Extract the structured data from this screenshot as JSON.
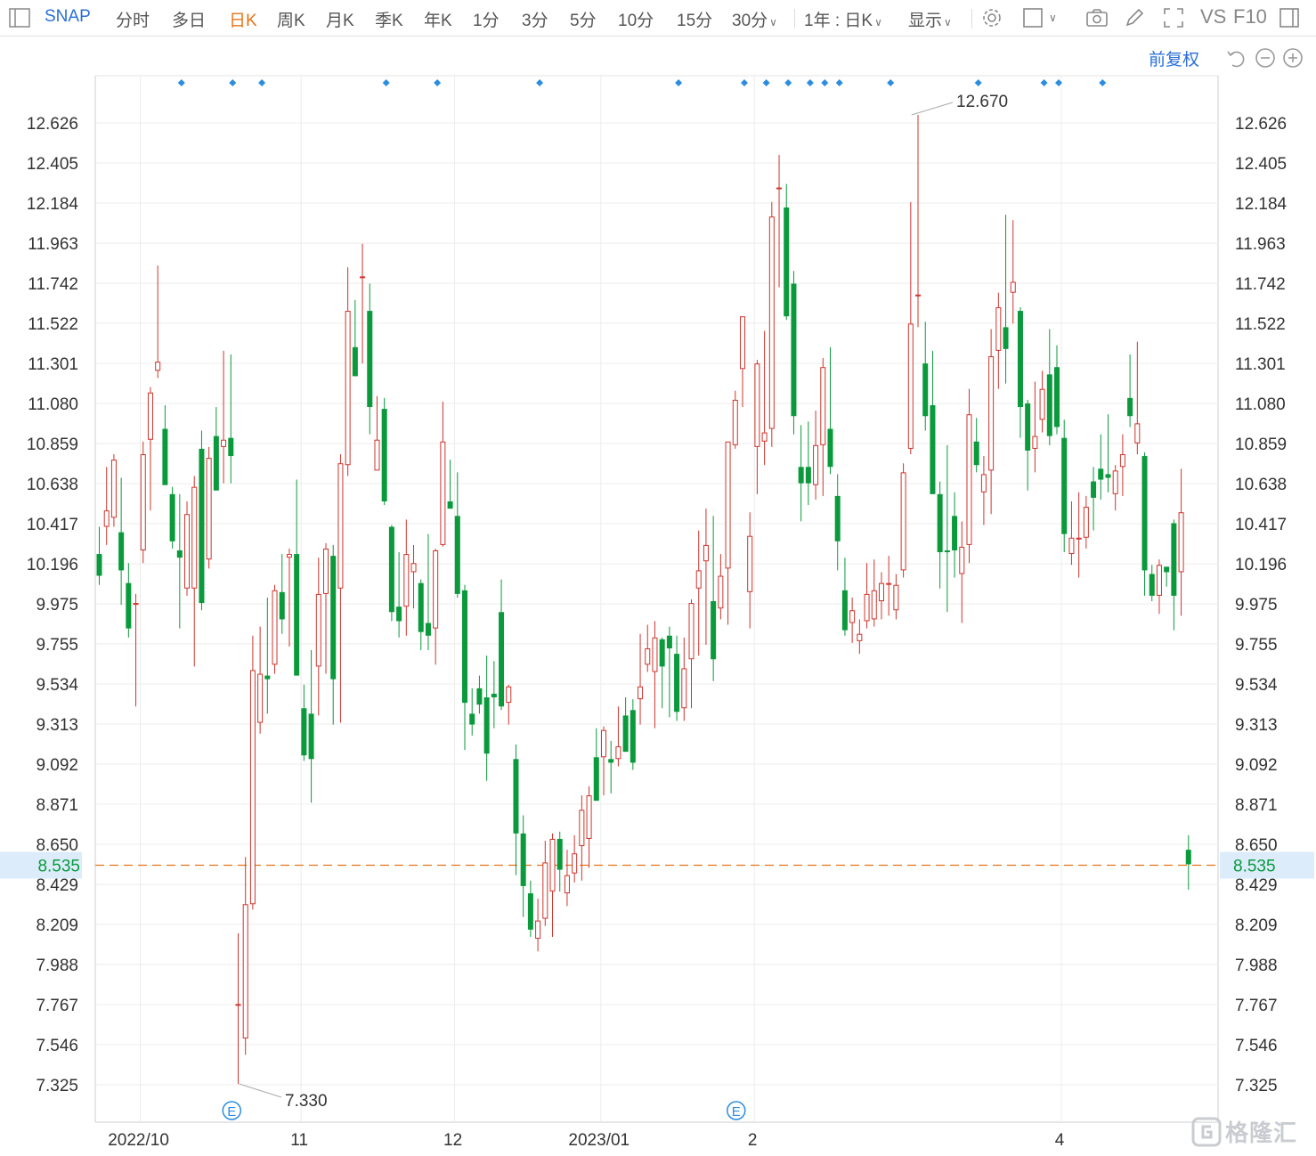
{
  "toolbar": {
    "ticker": "SNAP",
    "tabs": [
      "分时",
      "多日",
      "日K",
      "周K",
      "月K",
      "季K",
      "年K",
      "1分",
      "3分",
      "5分",
      "10分",
      "15分",
      "30分"
    ],
    "active_tab": "日K",
    "range_select": "1年 : 日K",
    "display_select": "显示",
    "vs_label": "VS",
    "f10_label": "F10"
  },
  "subbar": {
    "adjust_label": "前复权"
  },
  "watermark": {
    "text": "格隆汇"
  },
  "colors": {
    "up": "#d0342c",
    "down": "#0a9a3c",
    "current_line": "#e8741a",
    "current_bg": "#dcecfb",
    "grid": "#ececec",
    "marker": "#2a8de0"
  },
  "chart_data": {
    "type": "candlestick",
    "y_ticks": [
      "12.626",
      "12.405",
      "12.184",
      "11.963",
      "11.742",
      "11.522",
      "11.301",
      "11.080",
      "10.859",
      "10.638",
      "10.417",
      "10.196",
      "9.975",
      "9.755",
      "9.534",
      "9.313",
      "9.092",
      "8.871",
      "8.650",
      "8.429",
      "8.209",
      "7.988",
      "7.767",
      "7.546",
      "7.325"
    ],
    "ylim": [
      7.105,
      12.847
    ],
    "x_labels": [
      {
        "label": "2022/10",
        "index": 5
      },
      {
        "label": "11",
        "index": 27
      },
      {
        "label": "12",
        "index": 48
      },
      {
        "label": "2023/01",
        "index": 68
      },
      {
        "label": "2",
        "index": 89
      },
      {
        "label": "4",
        "index": 131
      }
    ],
    "grid_lines_at_index": [
      5,
      27,
      48,
      68,
      89,
      131
    ],
    "current_price": "8.535",
    "max_annotation": {
      "label": "12.670",
      "index": 111,
      "value": 12.67
    },
    "min_annotation": {
      "label": "7.330",
      "index": 19,
      "value": 7.33
    },
    "earnings_markers": [
      {
        "label": "E",
        "index": 18
      },
      {
        "label": "E",
        "index": 87
      }
    ],
    "event_markers_at_index": [
      11,
      18,
      22,
      39,
      46,
      60,
      79,
      88,
      91,
      94,
      97,
      99,
      101,
      108,
      120,
      129,
      131,
      137
    ],
    "candles": [
      {
        "o": 10.25,
        "h": 10.4,
        "l": 10.08,
        "c": 10.13
      },
      {
        "o": 10.4,
        "h": 10.73,
        "l": 10.3,
        "c": 10.49
      },
      {
        "o": 10.45,
        "h": 10.8,
        "l": 10.4,
        "c": 10.77
      },
      {
        "o": 10.37,
        "h": 10.67,
        "l": 9.97,
        "c": 10.16
      },
      {
        "o": 10.09,
        "h": 10.2,
        "l": 9.79,
        "c": 9.84
      },
      {
        "o": 9.97,
        "h": 10.03,
        "l": 9.41,
        "c": 9.98
      },
      {
        "o": 10.27,
        "h": 10.87,
        "l": 10.2,
        "c": 10.8
      },
      {
        "o": 10.88,
        "h": 11.17,
        "l": 10.49,
        "c": 11.14
      },
      {
        "o": 11.26,
        "h": 11.84,
        "l": 11.22,
        "c": 11.31
      },
      {
        "o": 10.94,
        "h": 11.07,
        "l": 10.63,
        "c": 10.63
      },
      {
        "o": 10.58,
        "h": 10.62,
        "l": 10.28,
        "c": 10.32
      },
      {
        "o": 10.27,
        "h": 10.58,
        "l": 9.84,
        "c": 10.23
      },
      {
        "o": 10.06,
        "h": 10.54,
        "l": 10.02,
        "c": 10.47
      },
      {
        "o": 10.06,
        "h": 10.68,
        "l": 9.63,
        "c": 10.62
      },
      {
        "o": 10.83,
        "h": 10.93,
        "l": 9.94,
        "c": 9.98
      },
      {
        "o": 10.22,
        "h": 10.84,
        "l": 10.17,
        "c": 10.78
      },
      {
        "o": 10.9,
        "h": 11.06,
        "l": 10.6,
        "c": 10.6
      },
      {
        "o": 10.84,
        "h": 11.37,
        "l": 10.64,
        "c": 10.88
      },
      {
        "o": 10.89,
        "h": 11.35,
        "l": 10.64,
        "c": 10.79
      },
      {
        "o": 7.77,
        "h": 8.16,
        "l": 7.33,
        "c": 7.77
      },
      {
        "o": 7.58,
        "h": 8.58,
        "l": 7.49,
        "c": 8.32
      },
      {
        "o": 8.32,
        "h": 9.8,
        "l": 8.29,
        "c": 9.61
      },
      {
        "o": 9.32,
        "h": 9.85,
        "l": 9.26,
        "c": 9.59
      },
      {
        "o": 9.58,
        "h": 10.01,
        "l": 9.37,
        "c": 9.56
      },
      {
        "o": 9.64,
        "h": 10.08,
        "l": 9.59,
        "c": 10.05
      },
      {
        "o": 10.04,
        "h": 10.25,
        "l": 9.81,
        "c": 9.89
      },
      {
        "o": 10.23,
        "h": 10.28,
        "l": 9.74,
        "c": 10.25
      },
      {
        "o": 10.25,
        "h": 10.66,
        "l": 9.58,
        "c": 9.58
      },
      {
        "o": 9.4,
        "h": 9.53,
        "l": 9.11,
        "c": 9.14
      },
      {
        "o": 9.37,
        "h": 9.72,
        "l": 8.88,
        "c": 9.12
      },
      {
        "o": 9.63,
        "h": 10.23,
        "l": 9.36,
        "c": 10.03
      },
      {
        "o": 10.03,
        "h": 10.31,
        "l": 9.59,
        "c": 10.28
      },
      {
        "o": 10.24,
        "h": 10.3,
        "l": 9.31,
        "c": 9.56
      },
      {
        "o": 10.06,
        "h": 10.8,
        "l": 9.32,
        "c": 10.75
      },
      {
        "o": 10.74,
        "h": 11.83,
        "l": 10.68,
        "c": 11.59
      },
      {
        "o": 11.39,
        "h": 11.65,
        "l": 11.23,
        "c": 11.23
      },
      {
        "o": 11.78,
        "h": 11.96,
        "l": 11.3,
        "c": 11.78
      },
      {
        "o": 11.59,
        "h": 11.74,
        "l": 10.91,
        "c": 11.06
      },
      {
        "o": 10.71,
        "h": 11.12,
        "l": 10.71,
        "c": 10.88
      },
      {
        "o": 11.05,
        "h": 11.11,
        "l": 10.52,
        "c": 10.54
      },
      {
        "o": 10.4,
        "h": 10.41,
        "l": 9.88,
        "c": 9.93
      },
      {
        "o": 9.96,
        "h": 10.26,
        "l": 9.79,
        "c": 9.88
      },
      {
        "o": 9.96,
        "h": 10.44,
        "l": 9.8,
        "c": 10.25
      },
      {
        "o": 10.15,
        "h": 10.3,
        "l": 9.95,
        "c": 10.2
      },
      {
        "o": 10.09,
        "h": 10.11,
        "l": 9.72,
        "c": 9.82
      },
      {
        "o": 9.87,
        "h": 10.36,
        "l": 9.72,
        "c": 9.8
      },
      {
        "o": 9.84,
        "h": 10.28,
        "l": 9.64,
        "c": 10.27
      },
      {
        "o": 10.3,
        "h": 11.09,
        "l": 10.29,
        "c": 10.87
      },
      {
        "o": 10.54,
        "h": 10.77,
        "l": 10.5,
        "c": 10.5
      },
      {
        "o": 10.46,
        "h": 10.7,
        "l": 10.01,
        "c": 10.03
      },
      {
        "o": 10.05,
        "h": 10.08,
        "l": 9.17,
        "c": 9.43
      },
      {
        "o": 9.37,
        "h": 9.51,
        "l": 9.25,
        "c": 9.31
      },
      {
        "o": 9.51,
        "h": 9.58,
        "l": 9.37,
        "c": 9.42
      },
      {
        "o": 9.46,
        "h": 9.69,
        "l": 9.0,
        "c": 9.15
      },
      {
        "o": 9.48,
        "h": 9.66,
        "l": 9.29,
        "c": 9.46
      },
      {
        "o": 9.93,
        "h": 10.11,
        "l": 9.39,
        "c": 9.41
      },
      {
        "o": 9.43,
        "h": 9.53,
        "l": 9.31,
        "c": 9.52
      },
      {
        "o": 9.12,
        "h": 9.2,
        "l": 8.48,
        "c": 8.71
      },
      {
        "o": 8.71,
        "h": 8.81,
        "l": 8.25,
        "c": 8.42
      },
      {
        "o": 8.38,
        "h": 8.45,
        "l": 8.14,
        "c": 8.18
      },
      {
        "o": 8.13,
        "h": 8.35,
        "l": 8.06,
        "c": 8.23
      },
      {
        "o": 8.24,
        "h": 8.67,
        "l": 8.2,
        "c": 8.55
      },
      {
        "o": 8.39,
        "h": 8.71,
        "l": 8.14,
        "c": 8.68
      },
      {
        "o": 8.68,
        "h": 8.72,
        "l": 8.39,
        "c": 8.51
      },
      {
        "o": 8.38,
        "h": 8.62,
        "l": 8.31,
        "c": 8.48
      },
      {
        "o": 8.49,
        "h": 8.7,
        "l": 8.44,
        "c": 8.6
      },
      {
        "o": 8.64,
        "h": 8.92,
        "l": 8.45,
        "c": 8.84
      },
      {
        "o": 8.68,
        "h": 8.97,
        "l": 8.52,
        "c": 8.92
      },
      {
        "o": 9.13,
        "h": 9.29,
        "l": 8.92,
        "c": 8.89
      },
      {
        "o": 9.13,
        "h": 9.3,
        "l": 8.92,
        "c": 9.28
      },
      {
        "o": 9.12,
        "h": 9.22,
        "l": 8.93,
        "c": 9.1
      },
      {
        "o": 9.12,
        "h": 9.41,
        "l": 9.08,
        "c": 9.19
      },
      {
        "o": 9.36,
        "h": 9.46,
        "l": 9.16,
        "c": 9.16
      },
      {
        "o": 9.39,
        "h": 9.45,
        "l": 9.06,
        "c": 9.1
      },
      {
        "o": 9.45,
        "h": 9.81,
        "l": 9.31,
        "c": 9.52
      },
      {
        "o": 9.64,
        "h": 9.86,
        "l": 9.6,
        "c": 9.73
      },
      {
        "o": 9.6,
        "h": 9.88,
        "l": 9.29,
        "c": 9.79
      },
      {
        "o": 9.78,
        "h": 9.79,
        "l": 9.4,
        "c": 9.63
      },
      {
        "o": 9.8,
        "h": 9.85,
        "l": 9.35,
        "c": 9.73
      },
      {
        "o": 9.7,
        "h": 9.8,
        "l": 9.33,
        "c": 9.38
      },
      {
        "o": 9.4,
        "h": 9.79,
        "l": 9.33,
        "c": 9.62
      },
      {
        "o": 9.67,
        "h": 10.0,
        "l": 9.4,
        "c": 9.98
      },
      {
        "o": 10.06,
        "h": 10.38,
        "l": 9.69,
        "c": 10.16
      },
      {
        "o": 10.21,
        "h": 10.5,
        "l": 9.75,
        "c": 10.3
      },
      {
        "o": 9.99,
        "h": 10.46,
        "l": 9.55,
        "c": 9.67
      },
      {
        "o": 9.95,
        "h": 10.25,
        "l": 9.89,
        "c": 10.13
      },
      {
        "o": 10.17,
        "h": 10.82,
        "l": 9.86,
        "c": 10.87
      },
      {
        "o": 10.85,
        "h": 11.15,
        "l": 10.83,
        "c": 11.1
      },
      {
        "o": 11.27,
        "h": 11.55,
        "l": 11.06,
        "c": 11.56
      },
      {
        "o": 10.04,
        "h": 10.48,
        "l": 9.84,
        "c": 10.35
      },
      {
        "o": 10.84,
        "h": 11.32,
        "l": 10.58,
        "c": 11.3
      },
      {
        "o": 10.87,
        "h": 11.48,
        "l": 10.74,
        "c": 10.92
      },
      {
        "o": 10.94,
        "h": 12.19,
        "l": 10.84,
        "c": 12.11
      },
      {
        "o": 12.27,
        "h": 12.45,
        "l": 11.72,
        "c": 12.27
      },
      {
        "o": 12.16,
        "h": 12.29,
        "l": 11.54,
        "c": 11.56
      },
      {
        "o": 11.74,
        "h": 11.81,
        "l": 10.91,
        "c": 11.01
      },
      {
        "o": 10.73,
        "h": 10.96,
        "l": 10.43,
        "c": 10.64
      },
      {
        "o": 10.73,
        "h": 10.98,
        "l": 10.52,
        "c": 10.64
      },
      {
        "o": 10.63,
        "h": 11.04,
        "l": 10.55,
        "c": 10.85
      },
      {
        "o": 10.85,
        "h": 11.33,
        "l": 10.57,
        "c": 11.28
      },
      {
        "o": 10.94,
        "h": 11.39,
        "l": 10.69,
        "c": 10.73
      },
      {
        "o": 10.57,
        "h": 10.69,
        "l": 10.16,
        "c": 10.32
      },
      {
        "o": 10.05,
        "h": 10.23,
        "l": 9.8,
        "c": 9.83
      },
      {
        "o": 9.87,
        "h": 10.01,
        "l": 9.76,
        "c": 9.94
      },
      {
        "o": 9.77,
        "h": 9.89,
        "l": 9.7,
        "c": 9.81
      },
      {
        "o": 9.88,
        "h": 10.2,
        "l": 9.84,
        "c": 10.03
      },
      {
        "o": 9.89,
        "h": 10.22,
        "l": 9.85,
        "c": 10.05
      },
      {
        "o": 9.99,
        "h": 10.15,
        "l": 9.89,
        "c": 10.09
      },
      {
        "o": 10.08,
        "h": 10.24,
        "l": 9.91,
        "c": 10.09
      },
      {
        "o": 9.94,
        "h": 10.14,
        "l": 9.89,
        "c": 10.08
      },
      {
        "o": 10.16,
        "h": 10.75,
        "l": 10.12,
        "c": 10.7
      },
      {
        "o": 10.83,
        "h": 12.19,
        "l": 10.8,
        "c": 11.52
      },
      {
        "o": 11.67,
        "h": 12.67,
        "l": 11.5,
        "c": 11.68
      },
      {
        "o": 11.3,
        "h": 11.53,
        "l": 10.93,
        "c": 11.01
      },
      {
        "o": 11.07,
        "h": 11.37,
        "l": 10.58,
        "c": 10.58
      },
      {
        "o": 10.58,
        "h": 10.65,
        "l": 10.06,
        "c": 10.26
      },
      {
        "o": 10.27,
        "h": 10.85,
        "l": 9.93,
        "c": 10.26
      },
      {
        "o": 10.46,
        "h": 10.59,
        "l": 10.12,
        "c": 10.27
      },
      {
        "o": 10.14,
        "h": 10.43,
        "l": 9.87,
        "c": 10.29
      },
      {
        "o": 10.3,
        "h": 11.16,
        "l": 10.2,
        "c": 11.02
      },
      {
        "o": 10.87,
        "h": 11.0,
        "l": 10.7,
        "c": 10.74
      },
      {
        "o": 10.59,
        "h": 10.79,
        "l": 10.41,
        "c": 10.69
      },
      {
        "o": 10.71,
        "h": 11.49,
        "l": 10.47,
        "c": 11.34
      },
      {
        "o": 11.37,
        "h": 11.69,
        "l": 11.16,
        "c": 11.61
      },
      {
        "o": 11.5,
        "h": 12.12,
        "l": 11.19,
        "c": 11.38
      },
      {
        "o": 11.69,
        "h": 12.09,
        "l": 11.52,
        "c": 11.75
      },
      {
        "o": 11.59,
        "h": 11.61,
        "l": 10.89,
        "c": 11.06
      },
      {
        "o": 11.08,
        "h": 11.1,
        "l": 10.6,
        "c": 10.82
      },
      {
        "o": 10.83,
        "h": 11.2,
        "l": 10.7,
        "c": 10.9
      },
      {
        "o": 10.99,
        "h": 11.26,
        "l": 10.92,
        "c": 11.16
      },
      {
        "o": 11.24,
        "h": 11.49,
        "l": 10.85,
        "c": 10.9
      },
      {
        "o": 11.28,
        "h": 11.4,
        "l": 10.91,
        "c": 10.95
      },
      {
        "o": 10.89,
        "h": 10.99,
        "l": 10.26,
        "c": 10.36
      },
      {
        "o": 10.25,
        "h": 10.54,
        "l": 10.19,
        "c": 10.34
      },
      {
        "o": 10.33,
        "h": 10.59,
        "l": 10.12,
        "c": 10.34
      },
      {
        "o": 10.34,
        "h": 10.57,
        "l": 10.28,
        "c": 10.51
      },
      {
        "o": 10.65,
        "h": 10.73,
        "l": 10.38,
        "c": 10.56
      },
      {
        "o": 10.72,
        "h": 10.91,
        "l": 10.55,
        "c": 10.66
      },
      {
        "o": 10.69,
        "h": 11.02,
        "l": 10.59,
        "c": 10.67
      },
      {
        "o": 10.58,
        "h": 10.74,
        "l": 10.49,
        "c": 10.71
      },
      {
        "o": 10.73,
        "h": 10.91,
        "l": 10.57,
        "c": 10.8
      },
      {
        "o": 11.11,
        "h": 11.35,
        "l": 10.95,
        "c": 11.01
      },
      {
        "o": 10.86,
        "h": 11.42,
        "l": 10.8,
        "c": 10.97
      },
      {
        "o": 10.79,
        "h": 10.81,
        "l": 10.02,
        "c": 10.16
      },
      {
        "o": 10.14,
        "h": 10.19,
        "l": 9.99,
        "c": 10.02
      },
      {
        "o": 10.02,
        "h": 10.22,
        "l": 9.92,
        "c": 10.19
      },
      {
        "o": 10.18,
        "h": 10.18,
        "l": 10.07,
        "c": 10.15
      },
      {
        "o": 10.42,
        "h": 10.44,
        "l": 9.83,
        "c": 10.02
      },
      {
        "o": 10.15,
        "h": 10.72,
        "l": 9.91,
        "c": 10.48
      },
      {
        "o": 8.62,
        "h": 8.7,
        "l": 8.4,
        "c": 8.54
      }
    ]
  }
}
